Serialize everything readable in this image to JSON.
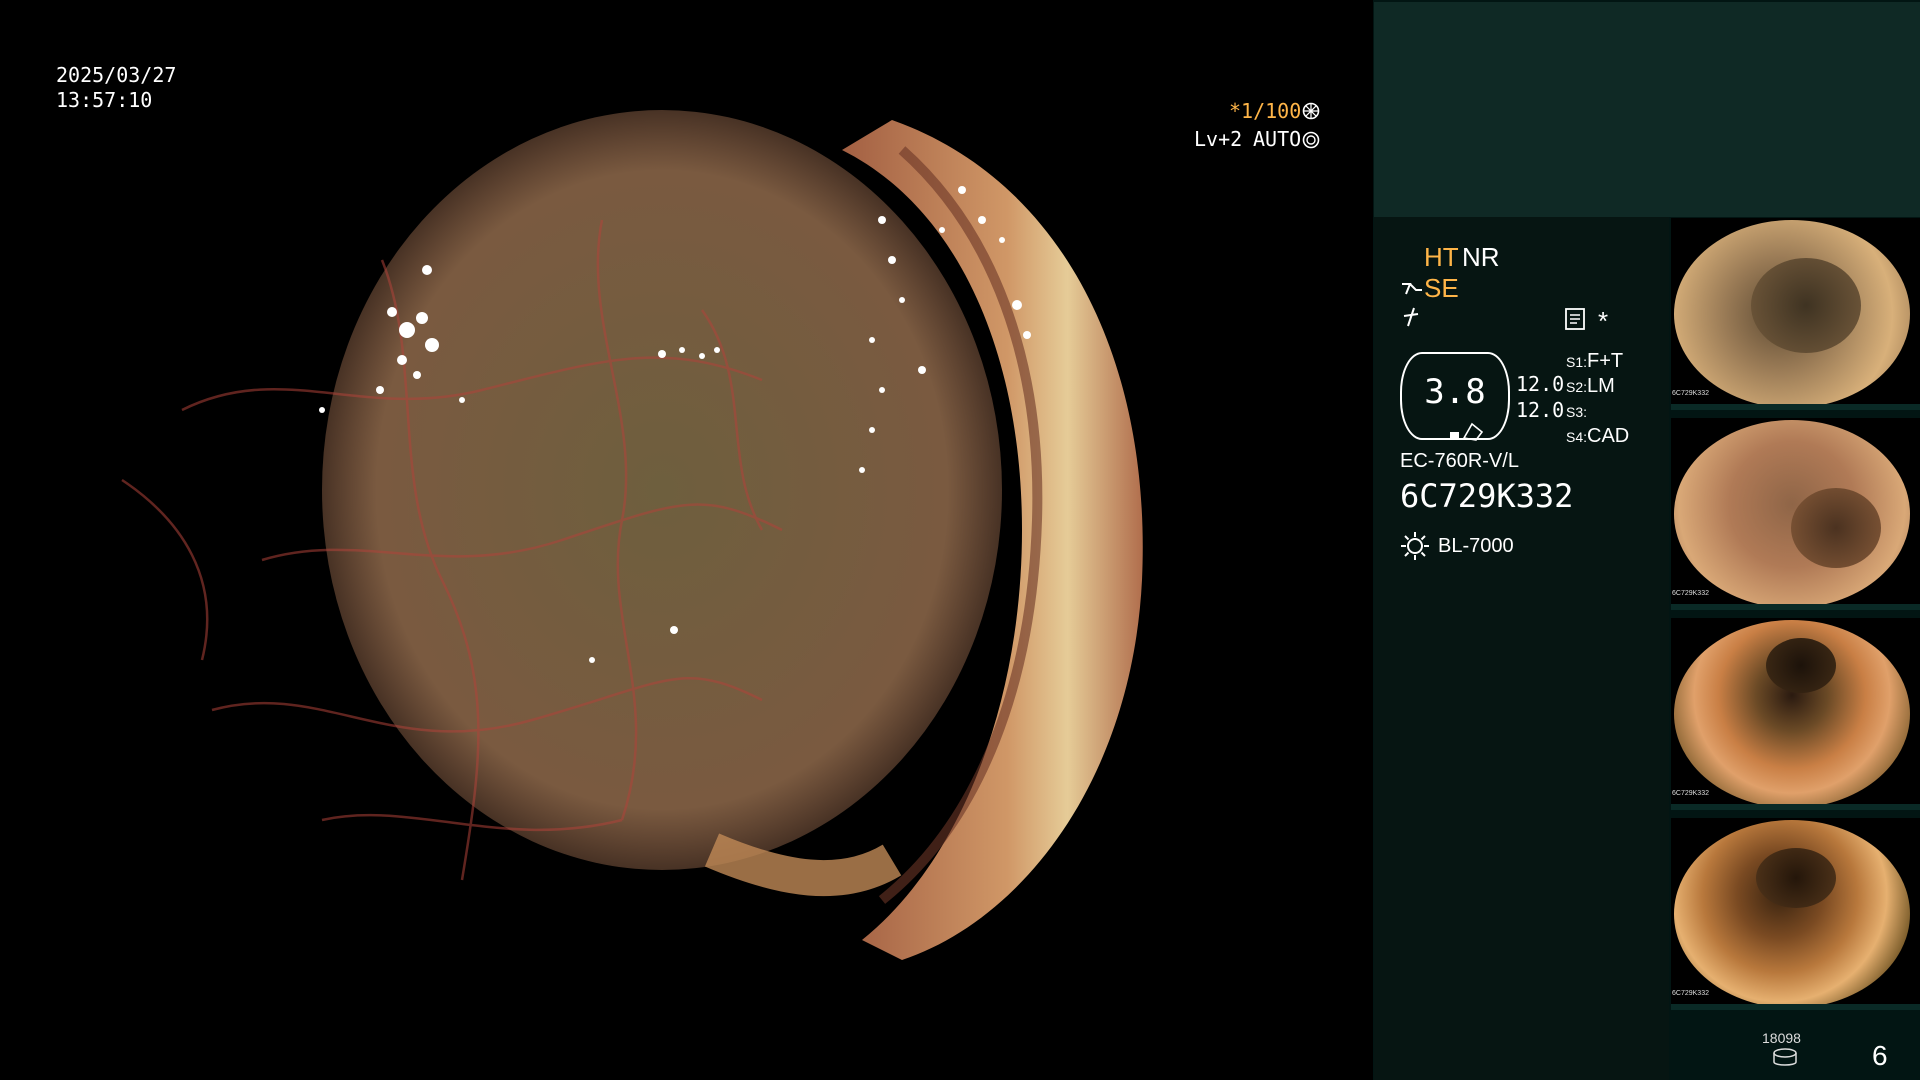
{
  "overlay": {
    "date": "2025/03/27",
    "time": "13:57:10",
    "shutter": "*1/100",
    "level": "Lv+2",
    "auto_label": "AUTO"
  },
  "status": {
    "ht_label": "HT",
    "nr_label": "NR",
    "se_label": "SE",
    "asterisk": "*",
    "gauge_value": "3.8",
    "value_a": "12.0",
    "value_b": "12.0",
    "scope_model": "EC-760R-V/L",
    "serial": "6C729K332",
    "light_source": "BL-7000"
  },
  "switches": [
    {
      "key": "S1",
      "value": "F+T"
    },
    {
      "key": "S2",
      "value": "LM"
    },
    {
      "key": "S3",
      "value": ""
    },
    {
      "key": "S4",
      "value": "CAD"
    }
  ],
  "thumbnail_serial": "6C729K332",
  "record_count": "18098",
  "page_number": "6",
  "colors": {
    "overlay_orange": "#ffb548",
    "panel_dark": "#021513",
    "panel_top": "#0f2925",
    "mucosa": "#a65f45"
  },
  "icons": [
    "shutter-icon",
    "auto-icon",
    "se-icon",
    "bolt-icon",
    "memo-icon",
    "gauge-icon",
    "light-source-icon",
    "storage-icon"
  ]
}
